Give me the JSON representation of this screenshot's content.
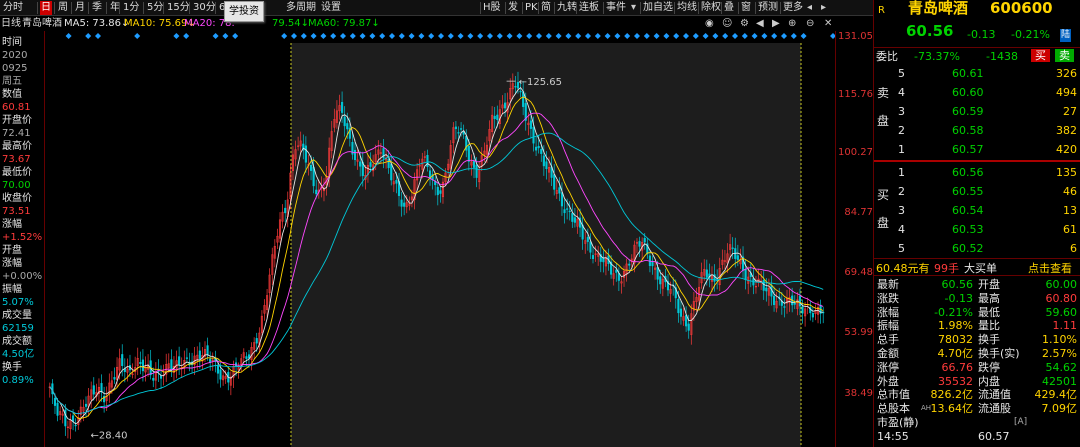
{
  "toolbar": {
    "items": [
      {
        "label": "分时",
        "active": false
      },
      {
        "label": "日",
        "active": true
      },
      {
        "label": "周",
        "active": false
      },
      {
        "label": "月",
        "active": false
      },
      {
        "label": "季",
        "active": false
      },
      {
        "label": "年",
        "active": false
      },
      {
        "label": "1分",
        "active": false
      },
      {
        "label": "5分",
        "active": false
      },
      {
        "label": "15分",
        "active": false
      },
      {
        "label": "30分",
        "active": false
      },
      {
        "label": "60分",
        "active": false
      }
    ],
    "tooltip": "学投资",
    "multi_period": "多周期",
    "settings": "设置",
    "right_items": [
      "H股",
      "发",
      "PK",
      "简",
      "九转",
      "连板",
      "事件",
      "加自选",
      "均线",
      "除权",
      "叠",
      "窗",
      "预测",
      "更多"
    ],
    "dropdown_arrow": "▾"
  },
  "ma": {
    "period_label": "日线",
    "stock_name": "青岛啤酒",
    "ma5": "MA5: 73.86↓",
    "ma10": "MA10: 75.69↓",
    "ma20": "MA20: 78.",
    "ma30_tail": "79.54↓",
    "ma60": "MA60: 79.87↓"
  },
  "left_panel": [
    {
      "t": "时间",
      "c": "white"
    },
    {
      "t": "2020",
      "c": "gray"
    },
    {
      "t": "0925",
      "c": "gray"
    },
    {
      "t": "周五",
      "c": "gray"
    },
    {
      "t": "数值",
      "c": "white"
    },
    {
      "t": "60.81",
      "c": "red"
    },
    {
      "t": "开盘价",
      "c": "white"
    },
    {
      "t": "72.41",
      "c": "gray"
    },
    {
      "t": "最高价",
      "c": "white"
    },
    {
      "t": "73.67",
      "c": "red"
    },
    {
      "t": "最低价",
      "c": "white"
    },
    {
      "t": "70.00",
      "c": "green"
    },
    {
      "t": "收盘价",
      "c": "white"
    },
    {
      "t": "73.51",
      "c": "red"
    },
    {
      "t": "涨幅",
      "c": "white"
    },
    {
      "t": "+1.52%",
      "c": "red"
    },
    {
      "t": "开盘",
      "c": "white"
    },
    {
      "t": "涨幅",
      "c": "white"
    },
    {
      "t": "+0.00%",
      "c": "gray"
    },
    {
      "t": "振幅",
      "c": "white"
    },
    {
      "t": "5.07%",
      "c": "cyan"
    },
    {
      "t": "成交量",
      "c": "white"
    },
    {
      "t": "62159",
      "c": "cyan"
    },
    {
      "t": "成交额",
      "c": "white"
    },
    {
      "t": "4.50亿",
      "c": "cyan"
    },
    {
      "t": "换手",
      "c": "white"
    },
    {
      "t": "0.89%",
      "c": "cyan"
    }
  ],
  "yaxis_ticks": [
    "131.05",
    "115.76",
    "100.27",
    "84.77",
    "69.48",
    "53.99",
    "38.49"
  ],
  "annotations": {
    "high": "125.65",
    "low": "28.40"
  },
  "quote": {
    "r_label": "R",
    "name": "青岛啤酒",
    "code": "600600",
    "price": "60.56",
    "change": "-0.13",
    "pct": "-0.21%",
    "board": "陆",
    "weibi_label": "委比",
    "weibi": "-73.37%",
    "weicha": "-1438",
    "buy_btn": "买",
    "sell_btn": "卖",
    "sell_side_label": [
      "卖",
      "盘"
    ],
    "buy_side_label": [
      "买",
      "盘"
    ],
    "asks": [
      {
        "n": "5",
        "p": "60.61",
        "v": "326"
      },
      {
        "n": "4",
        "p": "60.60",
        "v": "494"
      },
      {
        "n": "3",
        "p": "60.59",
        "v": "27"
      },
      {
        "n": "2",
        "p": "60.58",
        "v": "382"
      },
      {
        "n": "1",
        "p": "60.57",
        "v": "420"
      }
    ],
    "bids": [
      {
        "n": "1",
        "p": "60.56",
        "v": "135"
      },
      {
        "n": "2",
        "p": "60.55",
        "v": "46"
      },
      {
        "n": "3",
        "p": "60.54",
        "v": "13"
      },
      {
        "n": "4",
        "p": "60.53",
        "v": "61"
      },
      {
        "n": "5",
        "p": "60.52",
        "v": "6"
      }
    ],
    "bigorder": {
      "price": "60.48元有",
      "lots": "99手",
      "label": "大买单",
      "link": "点击查看"
    },
    "stats": [
      [
        "最新",
        "60.56",
        "开盘",
        "60.00"
      ],
      [
        "涨跌",
        "-0.13",
        "最高",
        "60.80"
      ],
      [
        "涨幅",
        "-0.21%",
        "最低",
        "59.60"
      ],
      [
        "振幅",
        "1.98%",
        "量比",
        "1.11"
      ],
      [
        "总手",
        "78032",
        "换手",
        "1.10%"
      ],
      [
        "金额",
        "4.70亿",
        "换手(实)",
        "2.57%"
      ],
      [
        "涨停",
        "66.76",
        "跌停",
        "54.62"
      ],
      [
        "外盘",
        "35532",
        "内盘",
        "42501"
      ],
      [
        "总市值",
        "826.2亿",
        "流通值",
        "429.4亿"
      ],
      [
        "总股本",
        "13.64亿",
        "流通股",
        "7.09亿"
      ],
      [
        "市盈(静)",
        "",
        "",
        ""
      ],
      [
        "14:55",
        "",
        "60.57",
        ""
      ]
    ],
    "ah_label": "AH",
    "a_label": "[A]"
  },
  "chart_data": {
    "type": "candlestick",
    "y_range": [
      28.4,
      131.05
    ],
    "max_point": 125.65,
    "min_point": 28.4,
    "last_close": 60.56,
    "ma_lines": [
      "MA5",
      "MA10",
      "MA20",
      "MA60"
    ],
    "highlight_region": "selected range",
    "approx_closes": [
      38,
      32,
      30,
      31,
      33,
      36,
      40,
      38,
      42,
      46,
      44,
      48,
      45,
      42,
      44,
      47,
      45,
      46,
      48,
      50,
      48,
      45,
      43,
      44,
      46,
      48,
      53,
      60,
      72,
      85,
      92,
      108,
      106,
      100,
      95,
      98,
      115,
      118,
      110,
      102,
      98,
      104,
      108,
      100,
      94,
      90,
      96,
      104,
      100,
      95,
      98,
      110,
      112,
      106,
      100,
      104,
      114,
      118,
      121,
      125,
      118,
      112,
      106,
      100,
      96,
      92,
      88,
      84,
      80,
      78,
      76,
      72,
      70,
      74,
      78,
      80,
      76,
      72,
      68,
      66,
      60,
      58,
      66,
      72,
      70,
      74,
      78,
      76,
      73,
      70,
      68,
      66,
      65,
      64,
      63,
      62,
      63,
      61,
      60.5
    ]
  },
  "colors": {
    "up": "#ff3b3b",
    "down": "#00c8d8",
    "ma5": "#e6e6e6",
    "ma10": "#ffd400",
    "ma20": "#ff48ff",
    "ma60": "#00d200",
    "border": "#660000"
  }
}
